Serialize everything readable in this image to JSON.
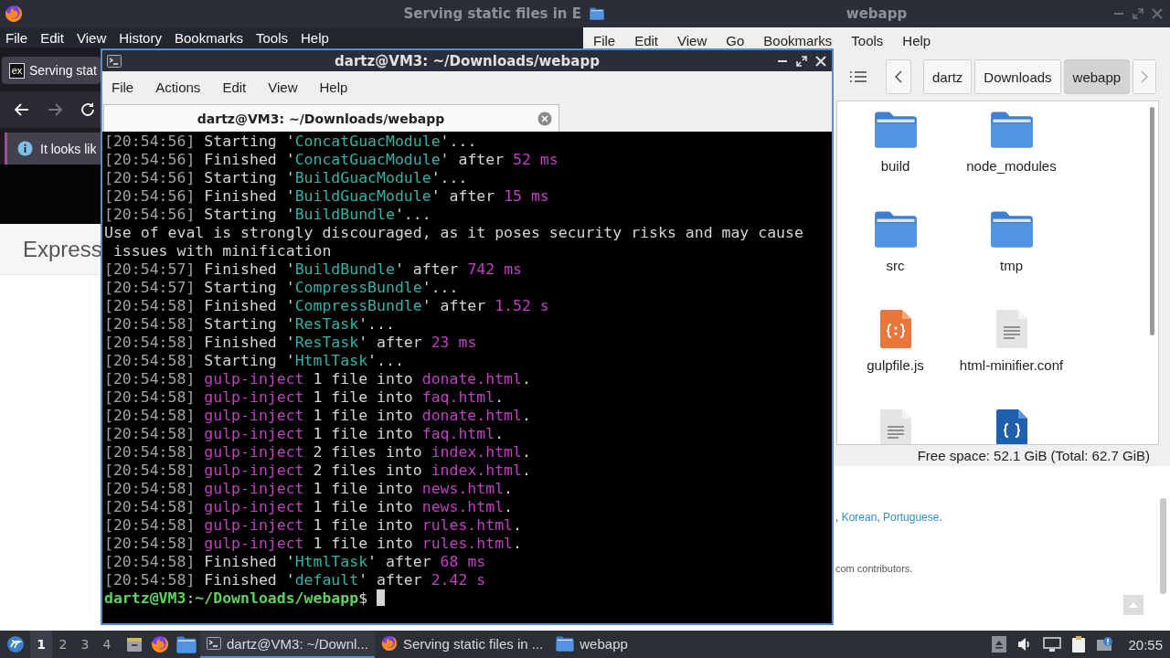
{
  "browser": {
    "title": "Serving static files in E",
    "menu": [
      "File",
      "Edit",
      "View",
      "History",
      "Bookmarks",
      "Tools",
      "Help"
    ],
    "tab": {
      "favicon": "ex",
      "label": "Serving stat"
    },
    "notice": "It looks lik",
    "heading": "Express",
    "languages": [
      {
        "text": ", ",
        "link": false
      },
      {
        "text": "Korean",
        "link": true
      },
      {
        "text": ", ",
        "link": false
      },
      {
        "text": "Portuguese",
        "link": true
      },
      {
        "text": ".",
        "link": false
      }
    ],
    "credits": "com contributors."
  },
  "file_manager": {
    "title": "webapp",
    "menu": [
      "File",
      "Edit",
      "View",
      "Go",
      "Bookmarks",
      "Tools",
      "Help"
    ],
    "path": [
      {
        "label": "dartz",
        "selected": false
      },
      {
        "label": "Downloads",
        "selected": false
      },
      {
        "label": "webapp",
        "selected": true
      }
    ],
    "items": [
      {
        "name": "build",
        "kind": "folder"
      },
      {
        "name": "node_modules",
        "kind": "folder"
      },
      {
        "name": "src",
        "kind": "folder"
      },
      {
        "name": "tmp",
        "kind": "folder"
      },
      {
        "name": "gulpfile.js",
        "kind": "script"
      },
      {
        "name": "html-minifier.conf",
        "kind": "text"
      },
      {
        "kind": "text"
      },
      {
        "kind": "json"
      }
    ],
    "status": "Free space: 52.1 GiB (Total: 62.7 GiB)"
  },
  "terminal": {
    "title": "dartz@VM3: ~/Downloads/webapp",
    "menu": [
      "File",
      "Actions",
      "Edit",
      "View",
      "Help"
    ],
    "tab": "dartz@VM3: ~/Downloads/webapp",
    "lines": [
      [
        {
          "text": "[20:54:56]",
          "kind": "time"
        },
        {
          "text": " Starting '",
          "kind": "text"
        },
        {
          "text": "ConcatGuacModule",
          "kind": "name"
        },
        {
          "text": "'...",
          "kind": "text"
        }
      ],
      [
        {
          "text": "[20:54:56]",
          "kind": "time"
        },
        {
          "text": " Finished '",
          "kind": "text"
        },
        {
          "text": "ConcatGuacModule",
          "kind": "name"
        },
        {
          "text": "' after ",
          "kind": "text"
        },
        {
          "text": "52 ms",
          "kind": "num"
        }
      ],
      [
        {
          "text": "[20:54:56]",
          "kind": "time"
        },
        {
          "text": " Starting '",
          "kind": "text"
        },
        {
          "text": "BuildGuacModule",
          "kind": "name"
        },
        {
          "text": "'...",
          "kind": "text"
        }
      ],
      [
        {
          "text": "[20:54:56]",
          "kind": "time"
        },
        {
          "text": " Finished '",
          "kind": "text"
        },
        {
          "text": "BuildGuacModule",
          "kind": "name"
        },
        {
          "text": "' after ",
          "kind": "text"
        },
        {
          "text": "15 ms",
          "kind": "num"
        }
      ],
      [
        {
          "text": "[20:54:56]",
          "kind": "time"
        },
        {
          "text": " Starting '",
          "kind": "text"
        },
        {
          "text": "BuildBundle",
          "kind": "name"
        },
        {
          "text": "'...",
          "kind": "text"
        }
      ],
      [
        {
          "text": "Use of eval is strongly discouraged, as it poses security risks and may cause",
          "kind": "text"
        }
      ],
      [
        {
          "text": " issues with minification",
          "kind": "text"
        }
      ],
      [
        {
          "text": "[20:54:57]",
          "kind": "time"
        },
        {
          "text": " Finished '",
          "kind": "text"
        },
        {
          "text": "BuildBundle",
          "kind": "name"
        },
        {
          "text": "' after ",
          "kind": "text"
        },
        {
          "text": "742 ms",
          "kind": "num"
        }
      ],
      [
        {
          "text": "[20:54:57]",
          "kind": "time"
        },
        {
          "text": " Starting '",
          "kind": "text"
        },
        {
          "text": "CompressBundle",
          "kind": "name"
        },
        {
          "text": "'...",
          "kind": "text"
        }
      ],
      [
        {
          "text": "[20:54:58]",
          "kind": "time"
        },
        {
          "text": " Finished '",
          "kind": "text"
        },
        {
          "text": "CompressBundle",
          "kind": "name"
        },
        {
          "text": "' after ",
          "kind": "text"
        },
        {
          "text": "1.52 s",
          "kind": "num"
        }
      ],
      [
        {
          "text": "[20:54:58]",
          "kind": "time"
        },
        {
          "text": " Starting '",
          "kind": "text"
        },
        {
          "text": "ResTask",
          "kind": "name"
        },
        {
          "text": "'...",
          "kind": "text"
        }
      ],
      [
        {
          "text": "[20:54:58]",
          "kind": "time"
        },
        {
          "text": " Finished '",
          "kind": "text"
        },
        {
          "text": "ResTask",
          "kind": "name"
        },
        {
          "text": "' after ",
          "kind": "text"
        },
        {
          "text": "23 ms",
          "kind": "num"
        }
      ],
      [
        {
          "text": "[20:54:58]",
          "kind": "time"
        },
        {
          "text": " Starting '",
          "kind": "text"
        },
        {
          "text": "HtmlTask",
          "kind": "name"
        },
        {
          "text": "'...",
          "kind": "text"
        }
      ],
      [
        {
          "text": "[20:54:58]",
          "kind": "time"
        },
        {
          "text": " gulp-inject",
          "kind": "num"
        },
        {
          "text": " 1 file into ",
          "kind": "text"
        },
        {
          "text": "donate.html",
          "kind": "num"
        },
        {
          "text": ".",
          "kind": "text"
        }
      ],
      [
        {
          "text": "[20:54:58]",
          "kind": "time"
        },
        {
          "text": " gulp-inject",
          "kind": "num"
        },
        {
          "text": " 1 file into ",
          "kind": "text"
        },
        {
          "text": "faq.html",
          "kind": "num"
        },
        {
          "text": ".",
          "kind": "text"
        }
      ],
      [
        {
          "text": "[20:54:58]",
          "kind": "time"
        },
        {
          "text": " gulp-inject",
          "kind": "num"
        },
        {
          "text": " 1 file into ",
          "kind": "text"
        },
        {
          "text": "donate.html",
          "kind": "num"
        },
        {
          "text": ".",
          "kind": "text"
        }
      ],
      [
        {
          "text": "[20:54:58]",
          "kind": "time"
        },
        {
          "text": " gulp-inject",
          "kind": "num"
        },
        {
          "text": " 1 file into ",
          "kind": "text"
        },
        {
          "text": "faq.html",
          "kind": "num"
        },
        {
          "text": ".",
          "kind": "text"
        }
      ],
      [
        {
          "text": "[20:54:58]",
          "kind": "time"
        },
        {
          "text": " gulp-inject",
          "kind": "num"
        },
        {
          "text": " 2 files into ",
          "kind": "text"
        },
        {
          "text": "index.html",
          "kind": "num"
        },
        {
          "text": ".",
          "kind": "text"
        }
      ],
      [
        {
          "text": "[20:54:58]",
          "kind": "time"
        },
        {
          "text": " gulp-inject",
          "kind": "num"
        },
        {
          "text": " 2 files into ",
          "kind": "text"
        },
        {
          "text": "index.html",
          "kind": "num"
        },
        {
          "text": ".",
          "kind": "text"
        }
      ],
      [
        {
          "text": "[20:54:58]",
          "kind": "time"
        },
        {
          "text": " gulp-inject",
          "kind": "num"
        },
        {
          "text": " 1 file into ",
          "kind": "text"
        },
        {
          "text": "news.html",
          "kind": "num"
        },
        {
          "text": ".",
          "kind": "text"
        }
      ],
      [
        {
          "text": "[20:54:58]",
          "kind": "time"
        },
        {
          "text": " gulp-inject",
          "kind": "num"
        },
        {
          "text": " 1 file into ",
          "kind": "text"
        },
        {
          "text": "news.html",
          "kind": "num"
        },
        {
          "text": ".",
          "kind": "text"
        }
      ],
      [
        {
          "text": "[20:54:58]",
          "kind": "time"
        },
        {
          "text": " gulp-inject",
          "kind": "num"
        },
        {
          "text": " 1 file into ",
          "kind": "text"
        },
        {
          "text": "rules.html",
          "kind": "num"
        },
        {
          "text": ".",
          "kind": "text"
        }
      ],
      [
        {
          "text": "[20:54:58]",
          "kind": "time"
        },
        {
          "text": " gulp-inject",
          "kind": "num"
        },
        {
          "text": " 1 file into ",
          "kind": "text"
        },
        {
          "text": "rules.html",
          "kind": "num"
        },
        {
          "text": ".",
          "kind": "text"
        }
      ],
      [
        {
          "text": "[20:54:58]",
          "kind": "time"
        },
        {
          "text": " Finished '",
          "kind": "text"
        },
        {
          "text": "HtmlTask",
          "kind": "name"
        },
        {
          "text": "' after ",
          "kind": "text"
        },
        {
          "text": "68 ms",
          "kind": "num"
        }
      ],
      [
        {
          "text": "[20:54:58]",
          "kind": "time"
        },
        {
          "text": " Finished '",
          "kind": "text"
        },
        {
          "text": "default",
          "kind": "name"
        },
        {
          "text": "' after ",
          "kind": "text"
        },
        {
          "text": "2.42 s",
          "kind": "num"
        }
      ],
      [
        {
          "text": "dartz@VM3",
          "kind": "prompt"
        },
        {
          "text": ":",
          "kind": "text"
        },
        {
          "text": "~/Downloads/webapp",
          "kind": "prompt"
        },
        {
          "text": "$",
          "kind": "text"
        }
      ]
    ]
  },
  "taskbar": {
    "workspaces": [
      {
        "label": "1",
        "selected": true
      },
      {
        "label": "2",
        "selected": false
      },
      {
        "label": "3",
        "selected": false
      },
      {
        "label": "4",
        "selected": false
      }
    ],
    "tasks": [
      {
        "kind": "terminal",
        "label": "dartz@VM3: ~/Downl...",
        "selected": true
      },
      {
        "kind": "browser",
        "label": "Serving static files in ...",
        "selected": false
      },
      {
        "kind": "folder",
        "label": "webapp",
        "selected": false
      }
    ],
    "clock": "20:55"
  }
}
